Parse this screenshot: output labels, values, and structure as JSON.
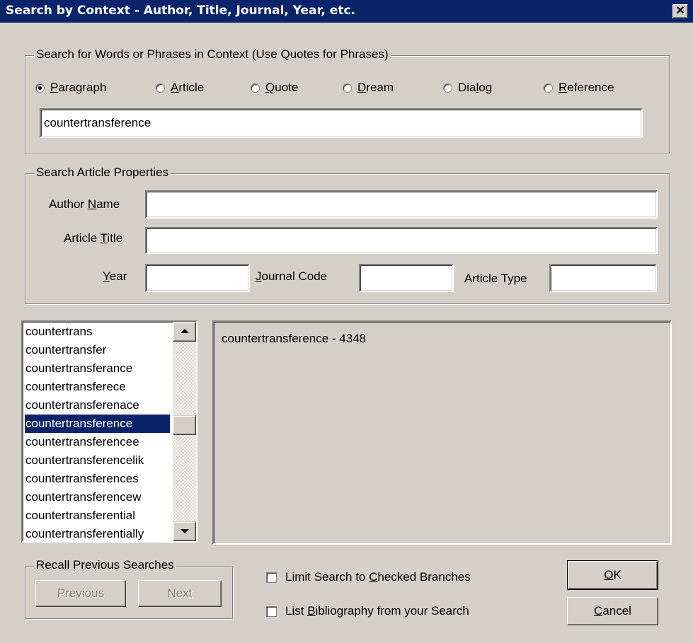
{
  "window": {
    "title": "Search by Context - Author, Title, Journal, Year, etc.",
    "close_glyph": "✕"
  },
  "context_group": {
    "legend": "Search for Words or Phrases in Context (Use Quotes for Phrases)",
    "options": [
      {
        "pre": "",
        "key": "P",
        "post": "aragraph",
        "checked": true
      },
      {
        "pre": "",
        "key": "A",
        "post": "rticle",
        "checked": false
      },
      {
        "pre": "",
        "key": "Q",
        "post": "uote",
        "checked": false
      },
      {
        "pre": "",
        "key": "D",
        "post": "ream",
        "checked": false
      },
      {
        "pre": "Dia",
        "key": "l",
        "post": "og",
        "checked": false
      },
      {
        "pre": "",
        "key": "R",
        "post": "eference",
        "checked": false
      }
    ],
    "query_value": "countertransference"
  },
  "properties_group": {
    "legend": "Search Article Properties",
    "author": {
      "pre": "Author ",
      "key": "N",
      "post": "ame",
      "value": ""
    },
    "title": {
      "pre": "Article ",
      "key": "T",
      "post": "itle",
      "value": ""
    },
    "year": {
      "pre": "",
      "key": "Y",
      "post": "ear",
      "value": ""
    },
    "journal": {
      "pre": "",
      "key": "J",
      "post": "ournal Code",
      "value": ""
    },
    "type": {
      "label": "Article Type",
      "value": ""
    }
  },
  "word_list": {
    "items": [
      "countertrans",
      "countertransfer",
      "countertransferance",
      "countertransferece",
      "countertransferenace",
      "countertransference",
      "countertransferencee",
      "countertransferencelik",
      "countertransferences",
      "countertransferencew",
      "countertransferential",
      "countertransferentially"
    ],
    "selected_index": 5
  },
  "results": {
    "text": "countertransference - 4348"
  },
  "recall_group": {
    "legend": "Recall Previous Searches",
    "previous": {
      "pre": "Pre",
      "key": "v",
      "post": "ious"
    },
    "next": {
      "pre": "Ne",
      "key": "x",
      "post": "t"
    }
  },
  "options": {
    "limit": {
      "pre": "Limit Search to ",
      "key": "C",
      "post": "hecked Branches",
      "checked": false
    },
    "bibliography": {
      "pre": "List ",
      "key": "B",
      "post": "ibliography from your Search",
      "checked": false
    }
  },
  "buttons": {
    "ok": {
      "pre": "",
      "key": "O",
      "post": "K"
    },
    "cancel": {
      "pre": "",
      "key": "C",
      "post": "ancel"
    }
  },
  "colors": {
    "face": "#d4d0c8",
    "titlebar": "#0a246a",
    "selection": "#0a246a"
  }
}
